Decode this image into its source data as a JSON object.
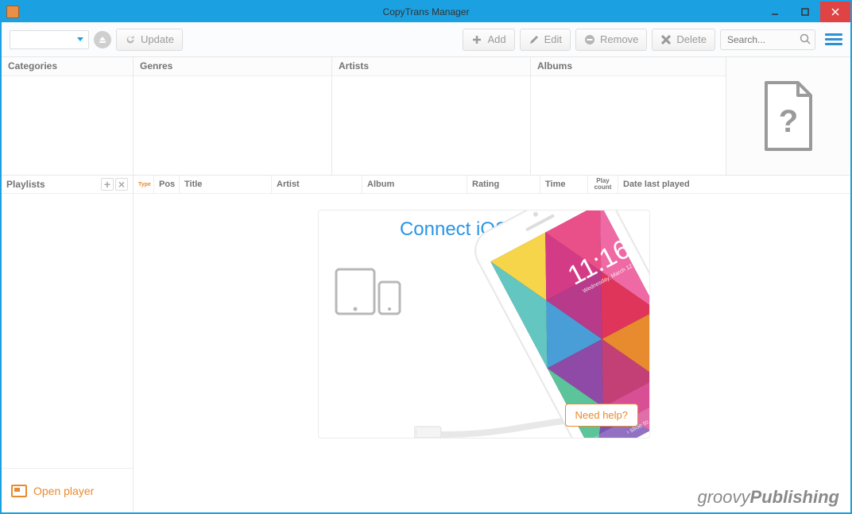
{
  "window": {
    "title": "CopyTrans Manager"
  },
  "toolbar": {
    "update": "Update",
    "add": "Add",
    "edit": "Edit",
    "remove": "Remove",
    "delete": "Delete",
    "search_placeholder": "Search..."
  },
  "browser": {
    "categories": "Categories",
    "genres": "Genres",
    "artists": "Artists",
    "albums": "Albums"
  },
  "grid": {
    "playlists": "Playlists",
    "columns": {
      "type": "Type",
      "pos": "Pos",
      "title": "Title",
      "artist": "Artist",
      "album": "Album",
      "rating": "Rating",
      "time": "Time",
      "playcount": "Play count",
      "date_last_played": "Date last played"
    }
  },
  "sidebar": {
    "open_player": "Open player"
  },
  "connect": {
    "title": "Connect iOS device",
    "need_help": "Need help?",
    "phone_time": "11:16",
    "phone_date": "Wednesday, March 12"
  },
  "watermark": {
    "a": "groovy",
    "b": "Publishing"
  }
}
